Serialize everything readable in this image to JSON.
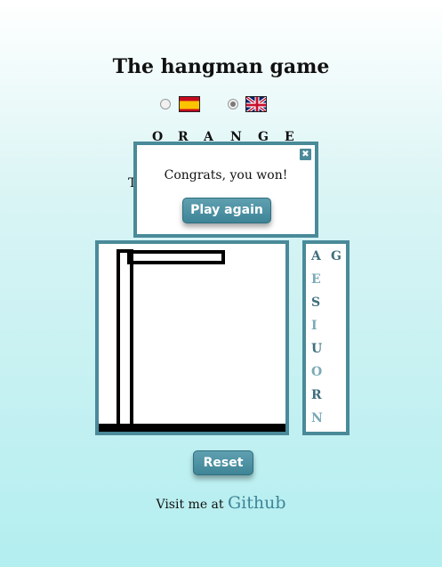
{
  "title": "The hangman game",
  "languages": [
    {
      "name": "spanish-flag",
      "selected": false
    },
    {
      "name": "uk-flag",
      "selected": true
    }
  ],
  "word": [
    "O",
    "R",
    "A",
    "N",
    "G",
    "E"
  ],
  "hidden_text": "T",
  "modal": {
    "message": "Congrats, you won!",
    "play_again_label": "Play again",
    "close_icon": "✖"
  },
  "used_letters": [
    "A",
    "G",
    "E",
    "S",
    "I",
    "U",
    "O",
    "R",
    "N"
  ],
  "reset_label": "Reset",
  "footer": {
    "prefix": "Visit me at",
    "link_label": "Github"
  },
  "colors": {
    "accent": "#4a8a99",
    "bg_top": "#ffffff",
    "bg_bottom": "#b3eef0"
  }
}
